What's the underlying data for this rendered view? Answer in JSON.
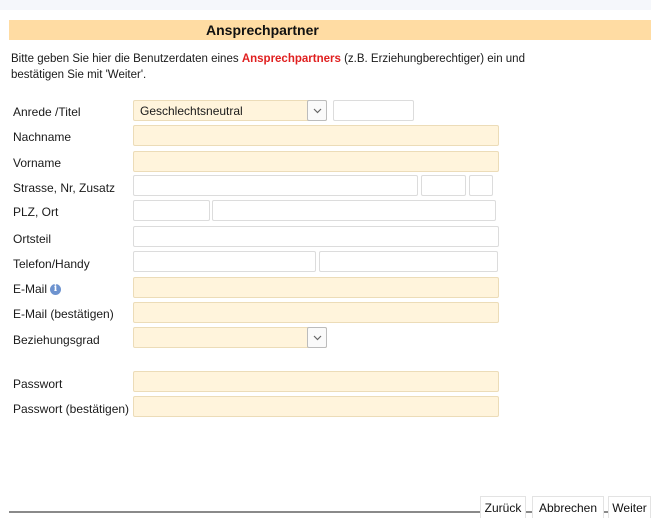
{
  "header": {
    "title": "Ansprechpartner"
  },
  "intro": {
    "part1": "Bitte geben Sie hier die Benutzerdaten eines ",
    "highlight": "Ansprechpartners",
    "part2": " (z.B. Erziehungberechtiger) ein und",
    "line2": "bestätigen Sie mit 'Weiter'."
  },
  "form": {
    "anrede": {
      "label": "Anrede /Titel",
      "value": "Geschlechtsneutral",
      "titel": ""
    },
    "nachname": {
      "label": "Nachname",
      "value": ""
    },
    "vorname": {
      "label": "Vorname",
      "value": ""
    },
    "strasse": {
      "label": "Strasse, Nr, Zusatz",
      "street": "",
      "nr": "",
      "zusatz": ""
    },
    "plz_ort": {
      "label": "PLZ, Ort",
      "plz": "",
      "ort": ""
    },
    "ortsteil": {
      "label": "Ortsteil",
      "value": ""
    },
    "telefon": {
      "label": "Telefon/Handy",
      "telefon": "",
      "handy": ""
    },
    "email": {
      "label": "E-Mail",
      "value": ""
    },
    "email_confirm": {
      "label": "E-Mail (bestätigen)",
      "value": ""
    },
    "beziehungsgrad": {
      "label": "Beziehungsgrad",
      "value": ""
    },
    "passwort": {
      "label": "Passwort",
      "value": ""
    },
    "passwort_confirm": {
      "label": "Passwort (bestätigen)",
      "value": ""
    }
  },
  "buttons": {
    "back": "Zurück",
    "cancel": "Abbrechen",
    "next": "Weiter"
  },
  "colors": {
    "header_bg": "#ffdca3",
    "required_bg": "#fff4dc",
    "highlight": "#e02020",
    "info_icon": "#6d93cf"
  }
}
